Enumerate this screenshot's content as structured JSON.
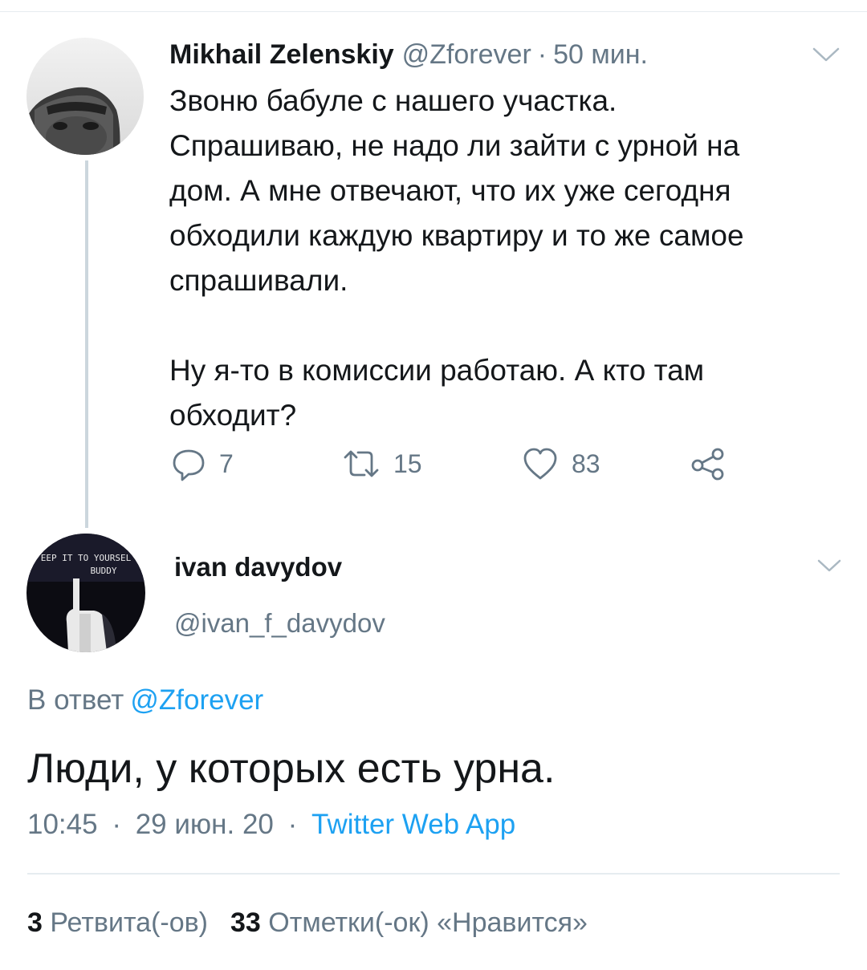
{
  "parent": {
    "name": "Mikhail Zelenskiy",
    "handle": "@Zforever",
    "separator": "·",
    "time": "50 мин.",
    "text_lines": [
      "Звоню бабуле с нашего участка.",
      "Спрашиваю, не надо ли зайти с урной на",
      "дом. А мне отвечают, что их уже сегодня",
      "обходили каждую квартиру и то же самое",
      "спрашивали."
    ],
    "text_lines_2": [
      "Ну я-то в комиссии работаю. А кто там",
      "обходит?"
    ],
    "replies": "7",
    "retweets": "15",
    "likes": "83"
  },
  "reply": {
    "name": "ivan davydov",
    "handle": "@ivan_f_davydov",
    "reply_to_prefix": "В ответ",
    "reply_to_mention": "@Zforever",
    "text": "Люди, у которых есть урна.",
    "time": "10:45",
    "date": "29 июн. 20",
    "separator": "·",
    "source": "Twitter Web App",
    "avatar_text_1": "EEP IT TO YOURSEL",
    "avatar_text_2": "BUDDY"
  },
  "stats": {
    "retweets_count": "3",
    "retweets_label": "Ретвита(-ов)",
    "likes_count": "33",
    "likes_label": "Отметки(-ок) «Нравится»"
  },
  "icons": {
    "reply": "reply-icon",
    "retweet": "retweet-icon",
    "like": "heart-icon",
    "share": "share-icon",
    "chevron": "chevron-down-icon"
  },
  "colors": {
    "text": "#14171a",
    "muted": "#657786",
    "link": "#1da1f2",
    "divider": "#e6ecf0"
  }
}
